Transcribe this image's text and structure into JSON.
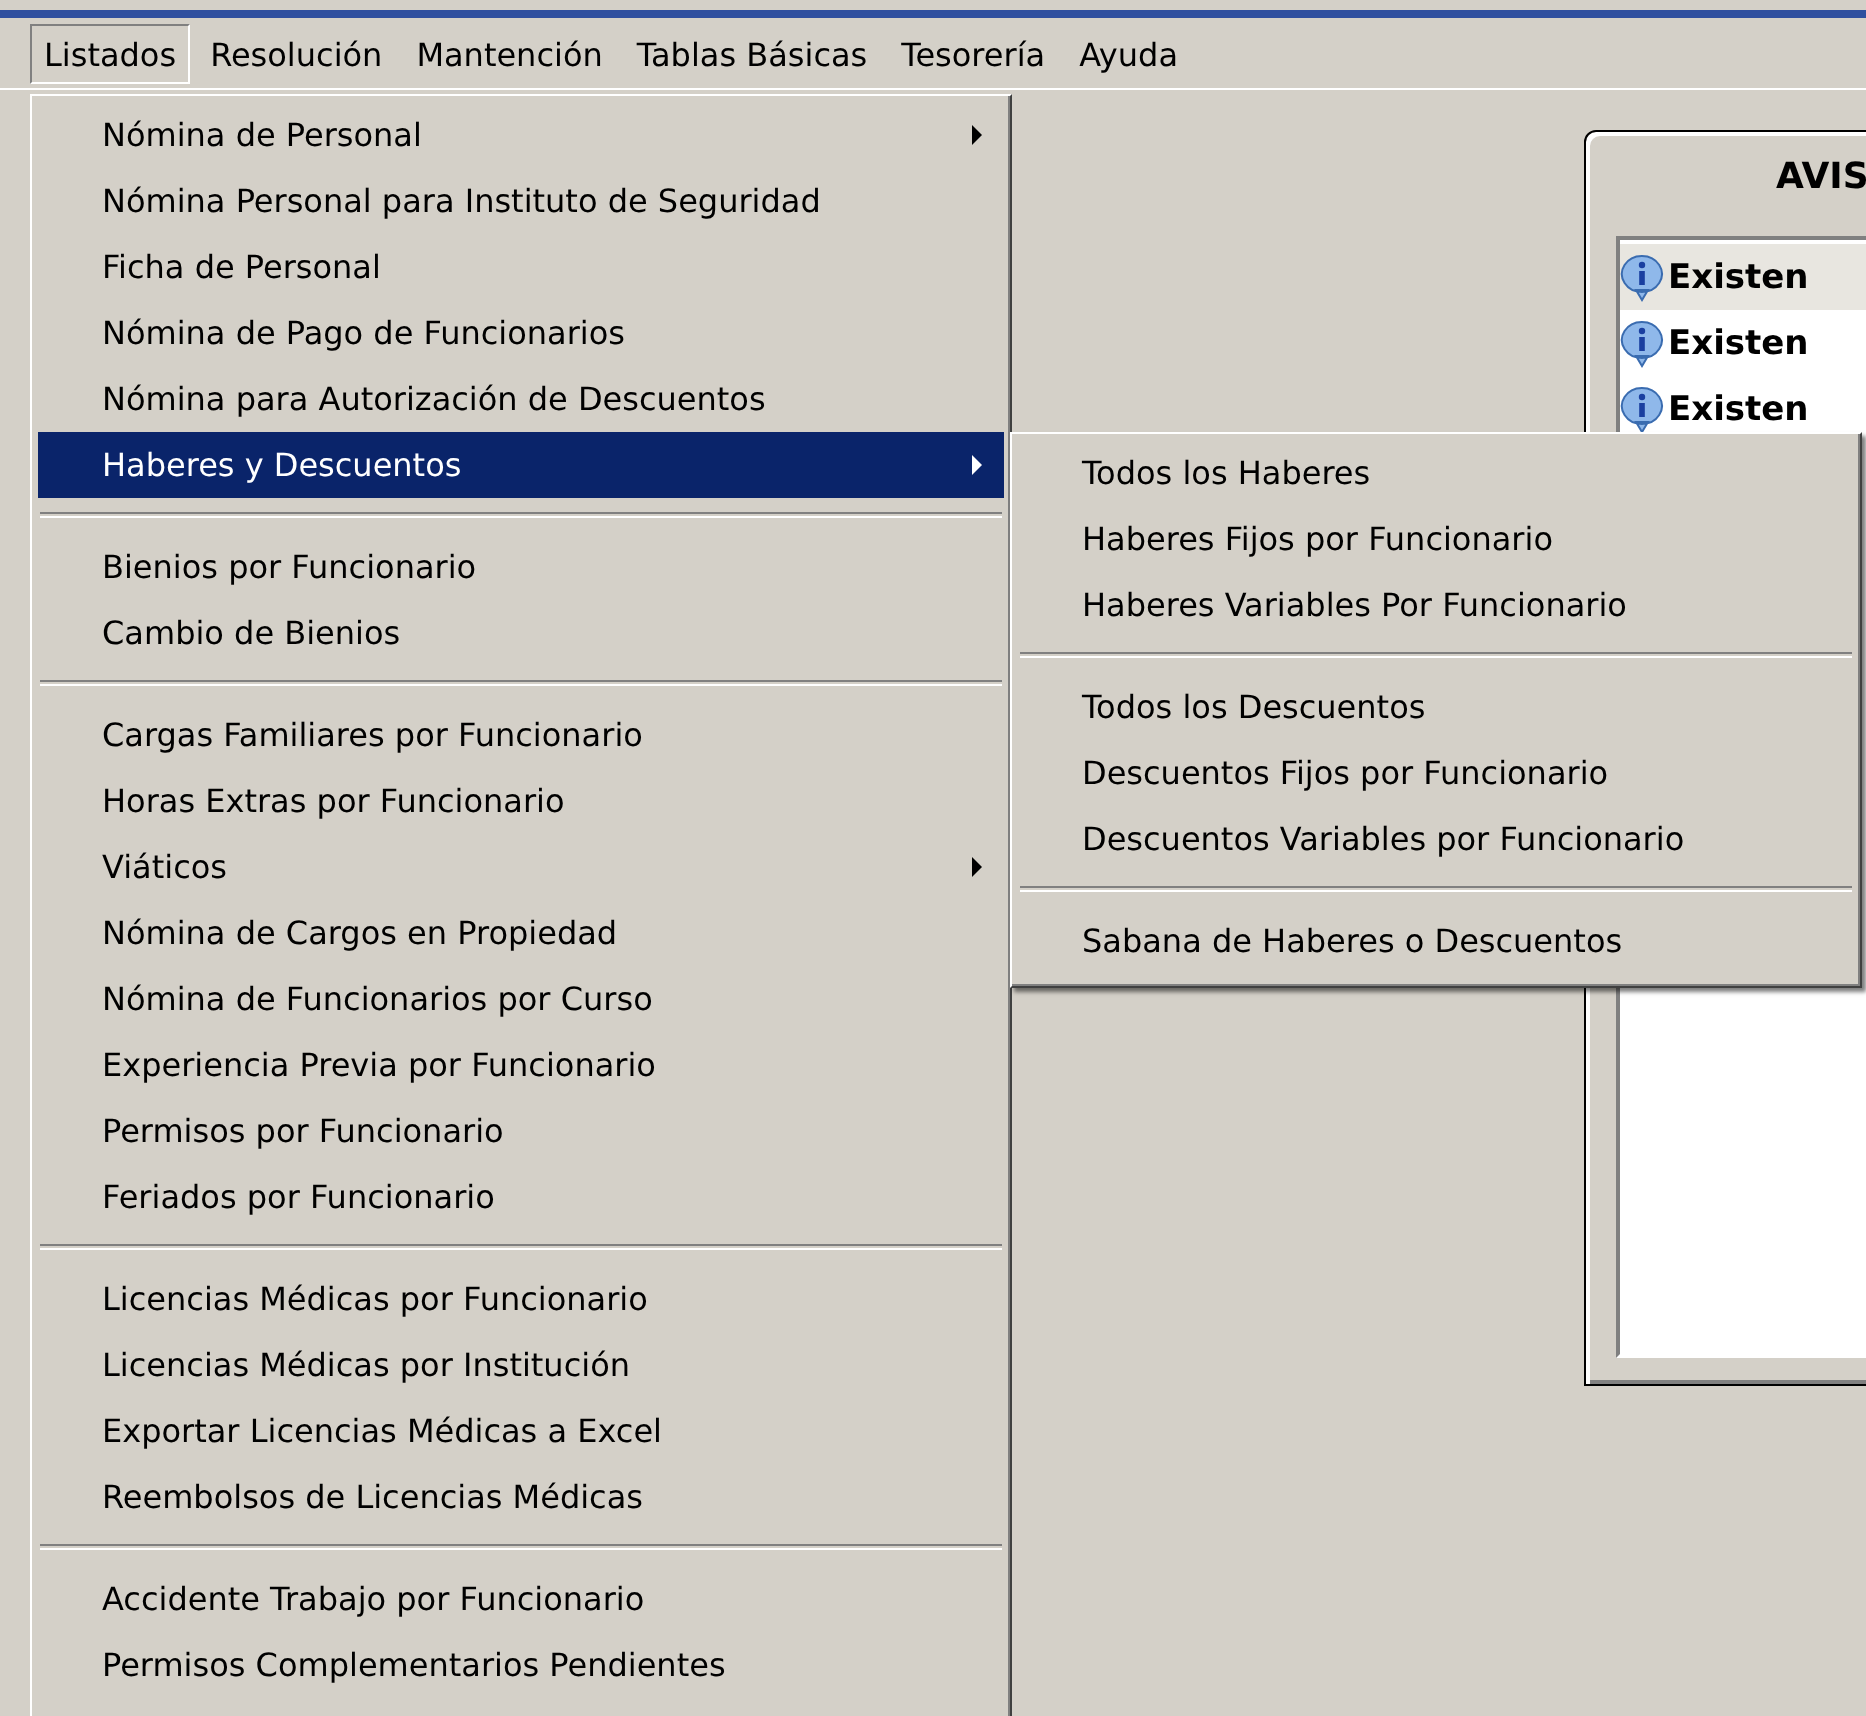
{
  "menubar": [
    {
      "label": "Listados",
      "selected": true
    },
    {
      "label": "Resolución",
      "selected": false
    },
    {
      "label": "Mantención",
      "selected": false
    },
    {
      "label": "Tablas Básicas",
      "selected": false
    },
    {
      "label": "Tesorería",
      "selected": false
    },
    {
      "label": "Ayuda",
      "selected": false
    }
  ],
  "menu": [
    {
      "kind": "item",
      "label": "Nómina de Personal",
      "submenu": true,
      "selected": false
    },
    {
      "kind": "item",
      "label": "Nómina Personal para Instituto de Seguridad",
      "submenu": false,
      "selected": false
    },
    {
      "kind": "item",
      "label": "Ficha de Personal",
      "submenu": false,
      "selected": false
    },
    {
      "kind": "item",
      "label": "Nómina de Pago de Funcionarios",
      "submenu": false,
      "selected": false
    },
    {
      "kind": "item",
      "label": "Nómina para Autorización de Descuentos",
      "submenu": false,
      "selected": false
    },
    {
      "kind": "item",
      "label": "Haberes y Descuentos",
      "submenu": true,
      "selected": true
    },
    {
      "kind": "separator"
    },
    {
      "kind": "item",
      "label": "Bienios por Funcionario",
      "submenu": false,
      "selected": false
    },
    {
      "kind": "item",
      "label": "Cambio de Bienios",
      "submenu": false,
      "selected": false
    },
    {
      "kind": "separator"
    },
    {
      "kind": "item",
      "label": "Cargas Familiares por Funcionario",
      "submenu": false,
      "selected": false
    },
    {
      "kind": "item",
      "label": "Horas Extras por Funcionario",
      "submenu": false,
      "selected": false
    },
    {
      "kind": "item",
      "label": "Viáticos",
      "submenu": true,
      "selected": false
    },
    {
      "kind": "item",
      "label": "Nómina de Cargos en Propiedad",
      "submenu": false,
      "selected": false
    },
    {
      "kind": "item",
      "label": "Nómina de Funcionarios por Curso",
      "submenu": false,
      "selected": false
    },
    {
      "kind": "item",
      "label": "Experiencia Previa por Funcionario",
      "submenu": false,
      "selected": false
    },
    {
      "kind": "item",
      "label": "Permisos por Funcionario",
      "submenu": false,
      "selected": false
    },
    {
      "kind": "item",
      "label": "Feriados por Funcionario",
      "submenu": false,
      "selected": false
    },
    {
      "kind": "separator"
    },
    {
      "kind": "item",
      "label": "Licencias Médicas por Funcionario",
      "submenu": false,
      "selected": false
    },
    {
      "kind": "item",
      "label": "Licencias Médicas por Institución",
      "submenu": false,
      "selected": false
    },
    {
      "kind": "item",
      "label": "Exportar Licencias Médicas a Excel",
      "submenu": false,
      "selected": false
    },
    {
      "kind": "item",
      "label": "Reembolsos de Licencias Médicas",
      "submenu": false,
      "selected": false
    },
    {
      "kind": "separator"
    },
    {
      "kind": "item",
      "label": "Accidente Trabajo por Funcionario",
      "submenu": false,
      "selected": false
    },
    {
      "kind": "item",
      "label": "Permisos Complementarios Pendientes",
      "submenu": false,
      "selected": false
    }
  ],
  "submenu": [
    {
      "kind": "item",
      "label": "Todos los Haberes",
      "selected": false
    },
    {
      "kind": "item",
      "label": "Haberes Fijos por Funcionario",
      "selected": false
    },
    {
      "kind": "item",
      "label": "Haberes Variables Por Funcionario",
      "selected": false
    },
    {
      "kind": "separator"
    },
    {
      "kind": "item",
      "label": "Todos los Descuentos",
      "selected": false
    },
    {
      "kind": "item",
      "label": "Descuentos Fijos por Funcionario",
      "selected": false
    },
    {
      "kind": "item",
      "label": "Descuentos Variables por Funcionario",
      "selected": false
    },
    {
      "kind": "separator"
    },
    {
      "kind": "item",
      "label": "Sabana de Haberes o Descuentos",
      "selected": false
    }
  ],
  "panel": {
    "title": "AVIS",
    "messages": [
      {
        "text": "Existen",
        "selected": true
      },
      {
        "text": "Existen",
        "selected": false
      },
      {
        "text": "Existen",
        "selected": false
      }
    ]
  }
}
